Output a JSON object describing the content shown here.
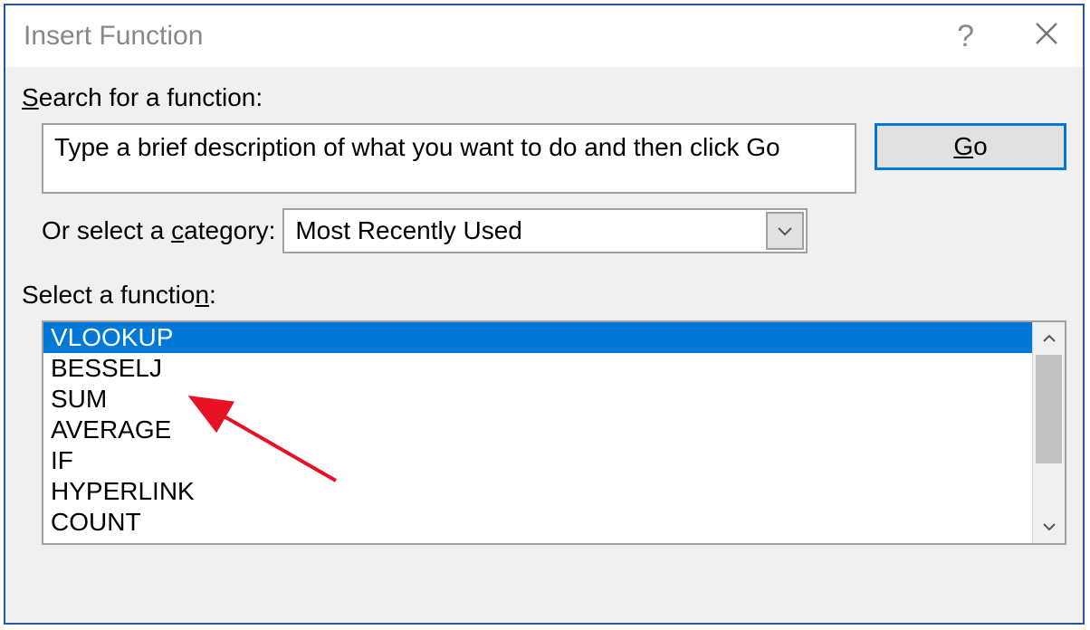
{
  "dialog": {
    "title": "Insert Function",
    "help": "?",
    "close": "✕"
  },
  "search": {
    "label_pre": "S",
    "label_post": "earch for a function:",
    "placeholder": "Type a brief description of what you want to do and then click Go",
    "go_pre": "G",
    "go_post": "o"
  },
  "category": {
    "label_pre": "Or select a ",
    "label_u": "c",
    "label_post": "ategory:",
    "value": "Most Recently Used"
  },
  "functions": {
    "label_pre": "Select a functio",
    "label_u": "n",
    "label_post": ":",
    "items": [
      "VLOOKUP",
      "BESSELJ",
      "SUM",
      "AVERAGE",
      "IF",
      "HYPERLINK",
      "COUNT"
    ],
    "selected_index": 0
  }
}
